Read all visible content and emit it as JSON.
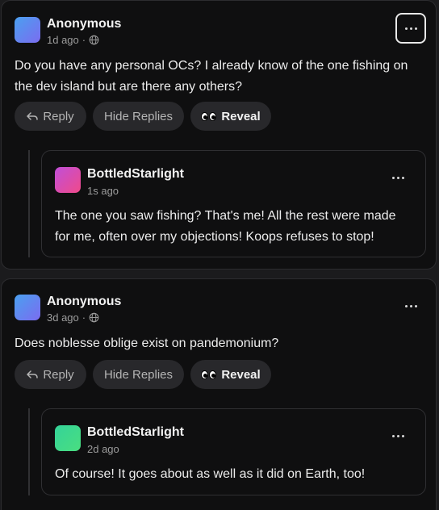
{
  "comments": [
    {
      "author": "Anonymous",
      "time": "1d ago",
      "text": "Do you have any personal OCs? I already know of the one fishing on the dev island but are there any others?",
      "actions": {
        "reply": "Reply",
        "hide": "Hide Replies",
        "reveal": "Reveal"
      },
      "avatar_color": "#5b7de8",
      "reply": {
        "author": "BottledStarlight",
        "time": "1s ago",
        "text": "The one you saw fishing? That's me! All the rest were made for me, often over my objections! Koops refuses to stop!",
        "avatar_color": "#e0479e"
      }
    },
    {
      "author": "Anonymous",
      "time": "3d ago",
      "text": "Does noblesse oblige exist on pandemonium?",
      "actions": {
        "reply": "Reply",
        "hide": "Hide Replies",
        "reveal": "Reveal"
      },
      "avatar_color": "#5b7de8",
      "reply": {
        "author": "BottledStarlight",
        "time": "2d ago",
        "text": "Of course! It goes about as well as it did on Earth, too!",
        "avatar_color": "#4ade80"
      }
    }
  ],
  "icons": {
    "more": "more-horizontal-icon",
    "globe": "globe-icon",
    "reply": "reply-arrow-icon",
    "reveal": "eyes-icon"
  }
}
